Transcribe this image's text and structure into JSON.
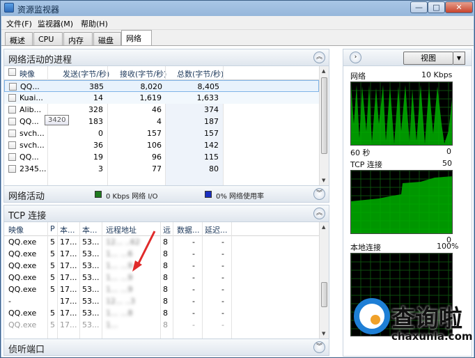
{
  "window": {
    "title": "资源监视器",
    "min_glyph": "—",
    "max_glyph": "□",
    "close_glyph": "✕"
  },
  "menu": {
    "file": "文件(F)",
    "monitor": "监视器(M)",
    "help": "帮助(H)"
  },
  "tabs": [
    {
      "label": "概述"
    },
    {
      "label": "CPU"
    },
    {
      "label": "内存"
    },
    {
      "label": "磁盘"
    },
    {
      "label": "网络",
      "active": true
    }
  ],
  "processes": {
    "title": "网络活动的进程",
    "columns": {
      "image": "映像",
      "send": "发送(字节/秒)",
      "recv": "接收(字节/秒)",
      "total": "总数(字节/秒)"
    },
    "rows": [
      {
        "image": "QQ...",
        "send": "385",
        "recv": "8,020",
        "total": "8,405"
      },
      {
        "image": "Kuai...",
        "send": "14",
        "recv": "1,619",
        "total": "1,633"
      },
      {
        "image": "Alib...",
        "send": "328",
        "recv": "46",
        "total": "374"
      },
      {
        "image": "QQ...",
        "send": "183",
        "recv": "4",
        "total": "187"
      },
      {
        "image": "svch...",
        "send": "0",
        "recv": "157",
        "total": "157"
      },
      {
        "image": "svch...",
        "send": "36",
        "recv": "106",
        "total": "142"
      },
      {
        "image": "QQ...",
        "send": "19",
        "recv": "96",
        "total": "115"
      },
      {
        "image": "2345...",
        "send": "3",
        "recv": "77",
        "total": "80"
      }
    ],
    "tooltip": "3420"
  },
  "activity": {
    "title": "网络活动",
    "io_label": "0 Kbps 网络 I/O",
    "usage_label": "0% 网络使用率",
    "io_color": "#1f7a1f",
    "usage_color": "#1a2fc0"
  },
  "tcp": {
    "title": "TCP 连接",
    "columns": {
      "image": "映像",
      "pid": "P",
      "local_addr": "本...",
      "local_port": "本...",
      "remote": "远程地址",
      "r": "远",
      "loss": "数据...",
      "latency": "延迟..."
    },
    "rows": [
      {
        "image": "QQ.exe",
        "pid": "5",
        "local_addr": "17...",
        "local_port": "53...",
        "remote": "12...  ..62",
        "r": "8",
        "loss": "-",
        "latency": "-"
      },
      {
        "image": "QQ.exe",
        "pid": "5",
        "local_addr": "17...",
        "local_port": "53...",
        "remote": "1...  ...6",
        "r": "8",
        "loss": "-",
        "latency": "-"
      },
      {
        "image": "QQ.exe",
        "pid": "5",
        "local_addr": "17...",
        "local_port": "53...",
        "remote": "1...  ...9",
        "r": "8",
        "loss": "-",
        "latency": "-"
      },
      {
        "image": "QQ.exe",
        "pid": "5",
        "local_addr": "17...",
        "local_port": "53...",
        "remote": "1...  ...9",
        "r": "8",
        "loss": "-",
        "latency": "-"
      },
      {
        "image": "QQ.exe",
        "pid": "5",
        "local_addr": "17...",
        "local_port": "53...",
        "remote": "1...  ...9",
        "r": "8",
        "loss": "-",
        "latency": "-"
      },
      {
        "image": "-",
        "pid": "",
        "local_addr": "17...",
        "local_port": "53...",
        "remote": "12...  ..3",
        "r": "8",
        "loss": "-",
        "latency": "-"
      },
      {
        "image": "QQ.exe",
        "pid": "5",
        "local_addr": "17...",
        "local_port": "53...",
        "remote": "1...  ...8",
        "r": "8",
        "loss": "-",
        "latency": "-"
      },
      {
        "image": "QQ.exe",
        "pid": "5",
        "local_addr": "17...",
        "local_port": "53...",
        "remote": "1...",
        "r": "8",
        "loss": "-",
        "latency": "-"
      }
    ]
  },
  "listen": {
    "title": "侦听端口"
  },
  "right": {
    "view_button": "视图",
    "network": {
      "label": "网络",
      "max": "10 Kbps",
      "time": "60 秒",
      "min": "0"
    },
    "tcp": {
      "label": "TCP 连接",
      "max": "50",
      "min": "0"
    },
    "local": {
      "label": "本地连接",
      "max": "100%"
    },
    "graph_color": "#00b000"
  },
  "watermark": {
    "text": "查询啦",
    "url": "chaxunla.com"
  }
}
